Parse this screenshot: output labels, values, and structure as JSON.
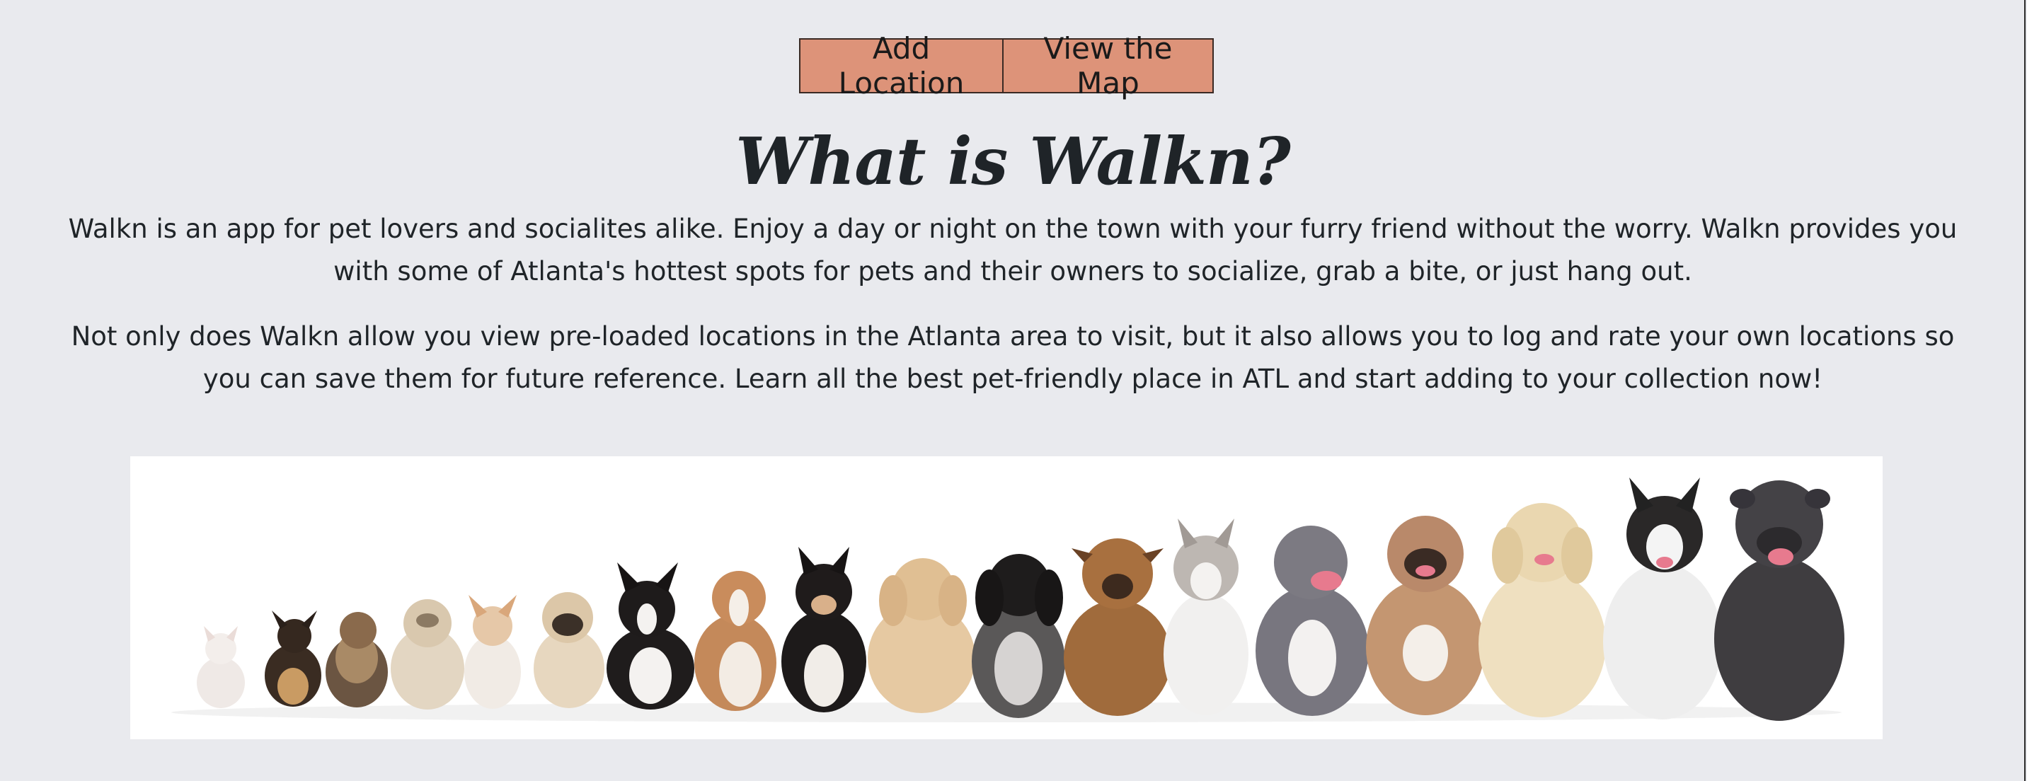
{
  "nav": {
    "add_location": "Add Location",
    "view_map": "View the Map"
  },
  "about": {
    "title": "What is Walkn?",
    "paragraph_1": "Walkn is an app for pet lovers and socialites alike. Enjoy a day or night on the town with your furry friend without the worry. Walkn provides you with some of Atlanta's hottest spots for pets and their owners to socialize, grab a bite, or just hang out.",
    "paragraph_2": "Not only does Walkn allow you view pre-loaded locations in the Atlanta area to visit, but it also allows you to log and rate your own locations so you can save them for future reference. Learn all the best pet-friendly place in ATL and start adding to your collection now!"
  },
  "colors": {
    "background": "#e9eaee",
    "button": "#dd9379",
    "text": "#1f2428"
  },
  "banner": {
    "icon": "dogs-lineup-image"
  }
}
